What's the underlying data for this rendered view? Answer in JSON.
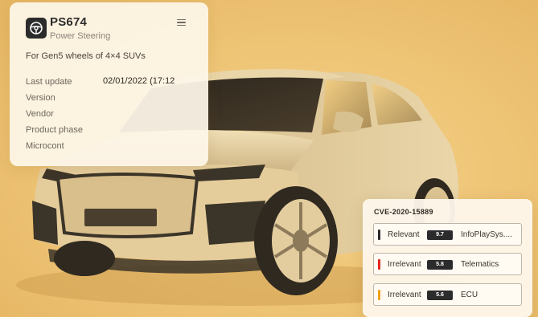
{
  "product": {
    "name": "PS674",
    "subtitle": "Power Steering",
    "description": "For Gen5 wheels of 4×4 SUVs",
    "logo_icon": "steering-wheel-icon",
    "menu_icon": "hamburger-menu-icon",
    "fields": [
      {
        "label": "Last update",
        "value": "02/01/2022 (17:12"
      },
      {
        "label": "Version",
        "value": ""
      },
      {
        "label": "Vendor",
        "value": ""
      },
      {
        "label": "Product phase",
        "value": ""
      },
      {
        "label": "Microcont",
        "value": ""
      }
    ]
  },
  "cve": {
    "id": "CVE-2020-15889",
    "rows": [
      {
        "status": "Relevant",
        "score": "9.7",
        "component": "InfoPlaySys....",
        "marker_color": "#2b2b2b"
      },
      {
        "status": "Irrelevant",
        "score": "5.8",
        "component": "Telematics",
        "marker_color": "#e0261d"
      },
      {
        "status": "Irrelevant",
        "score": "5.6",
        "component": "ECU",
        "marker_color": "#f0a21a"
      }
    ]
  },
  "colors": {
    "background": "#eec374",
    "card": "#fdf5e8",
    "car_body": "#e7d2a5",
    "dark_trim": "#3b3428"
  }
}
